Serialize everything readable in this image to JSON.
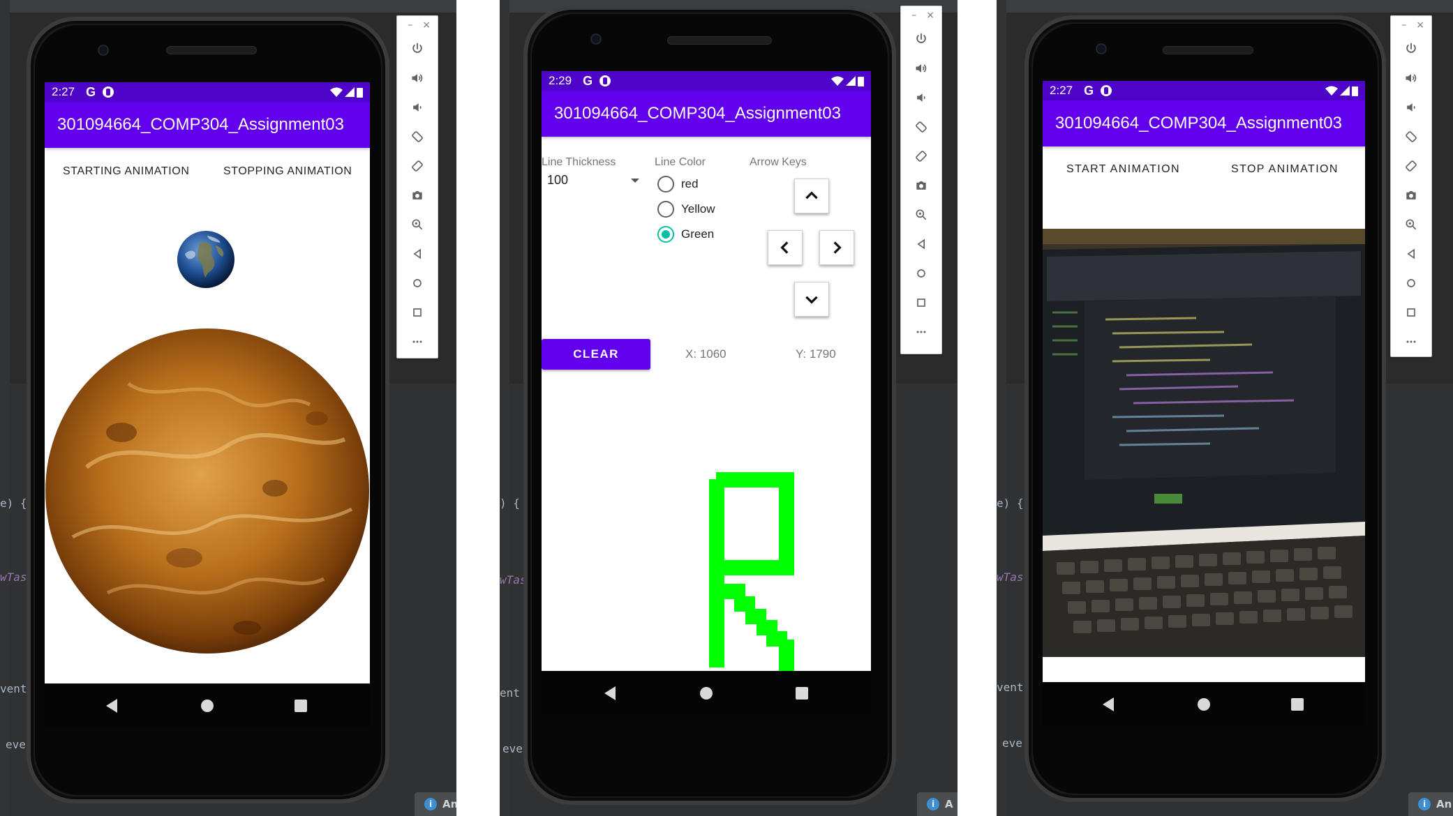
{
  "phone1": {
    "status_time": "2:27",
    "app_title": "301094664_COMP304_Assignment03",
    "start_label": "STARTING ANIMATION",
    "stop_label": "STOPPING ANIMATION",
    "icons": [
      "earth-image",
      "venus-image"
    ]
  },
  "phone2": {
    "status_time": "2:29",
    "app_title": "301094664_COMP304_Assignment03",
    "line_thickness_label": "Line Thickness",
    "line_thickness_value": "100",
    "line_color_label": "Line Color",
    "radio_options": [
      {
        "label": "red",
        "checked": false
      },
      {
        "label": "Yellow",
        "checked": false
      },
      {
        "label": "Green",
        "checked": true
      }
    ],
    "arrow_keys_label": "Arrow Keys",
    "clear_label": "CLEAR",
    "x_label": "X: 1060",
    "y_label": "Y: 1790",
    "drawing_color": "#00ff00"
  },
  "phone3": {
    "status_time": "2:27",
    "app_title": "301094664_COMP304_Assignment03",
    "start_label": "START ANIMATION",
    "stop_label": "STOP ANIMATION"
  },
  "ide": {
    "fragments": [
      "e) {",
      "wTas",
      "vent",
      "eve",
      ") {",
      "wTas",
      "ent",
      "eve",
      "e) {",
      "wTas",
      "vent",
      "eve"
    ],
    "info_chip": "An",
    "info_chip_short": "A"
  },
  "colors": {
    "statusbar": "#4f04c9",
    "appbar": "#6200ee",
    "accent": "#00bfa5"
  },
  "emulator_toolbar_icons": [
    "power-icon",
    "volume-up-icon",
    "volume-down-icon",
    "rotate-left-icon",
    "rotate-right-icon",
    "camera-icon",
    "zoom-icon",
    "back-icon",
    "home-icon",
    "overview-icon",
    "more-icon"
  ]
}
